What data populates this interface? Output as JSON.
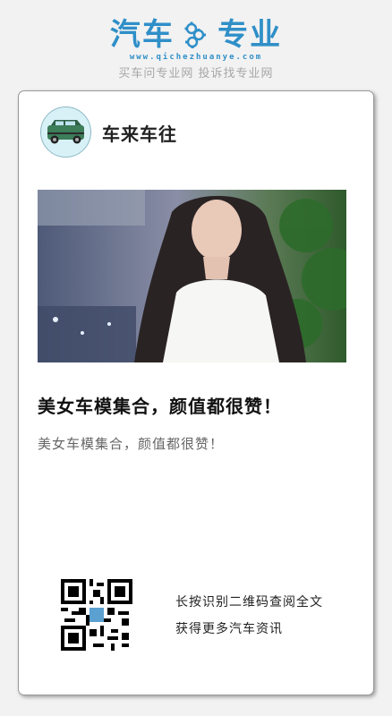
{
  "brand": {
    "name_left": "汽车",
    "name_right": "专业",
    "url": "www.qichezhuanye.com",
    "slogan": "买车问专业网 投诉找专业网",
    "accent": "#2f8fc8"
  },
  "account": {
    "name": "车来车往",
    "avatar_icon": "green-car-icon"
  },
  "article": {
    "image_desc_icon": "photo",
    "title": "美女车模集合，颜值都很赞！",
    "summary": "美女车模集合，颜值都很赞！"
  },
  "share": {
    "qr_icon": "qr-code-icon",
    "line1": "长按识别二维码查阅全文",
    "line2": "获得更多汽车资讯"
  }
}
